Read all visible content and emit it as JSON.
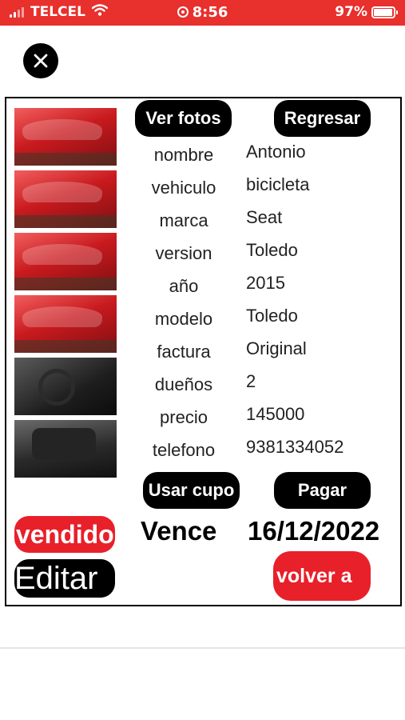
{
  "status_bar": {
    "carrier": "TELCEL",
    "time": "8:56",
    "battery_percent": "97%",
    "battery_level": 0.97,
    "background_color": "#e8302d"
  },
  "close_button": {
    "icon": "close-icon"
  },
  "photos": [
    {
      "name": "car-front-photo",
      "style": "red"
    },
    {
      "name": "car-side-photo",
      "style": "red"
    },
    {
      "name": "car-side-rear-photo",
      "style": "red"
    },
    {
      "name": "car-rear-photo",
      "style": "red"
    },
    {
      "name": "car-interior-photo",
      "style": "interior"
    },
    {
      "name": "car-seat-photo",
      "style": "seat"
    }
  ],
  "buttons": {
    "ver_fotos": "Ver fotos",
    "regresar": "Regresar",
    "usar_cupo": "Usar cupo",
    "pagar": "Pagar",
    "vendido": "vendido",
    "editar": "Editar",
    "volver": "volver a"
  },
  "details": [
    {
      "label": "nombre",
      "value": "Antonio"
    },
    {
      "label": "vehiculo",
      "value": "bicicleta"
    },
    {
      "label": "marca",
      "value": "Seat"
    },
    {
      "label": "version",
      "value": "Toledo"
    },
    {
      "label": "año",
      "value": "2015"
    },
    {
      "label": "modelo",
      "value": "Toledo"
    },
    {
      "label": "factura",
      "value": "Original"
    },
    {
      "label": "dueños",
      "value": "2"
    },
    {
      "label": "precio",
      "value": "145000"
    },
    {
      "label": "telefono",
      "value": "9381334052"
    }
  ],
  "expiry": {
    "label": "Vence",
    "date": "16/12/2022"
  },
  "colors": {
    "accent_red": "#e8202a",
    "black": "#000000"
  }
}
